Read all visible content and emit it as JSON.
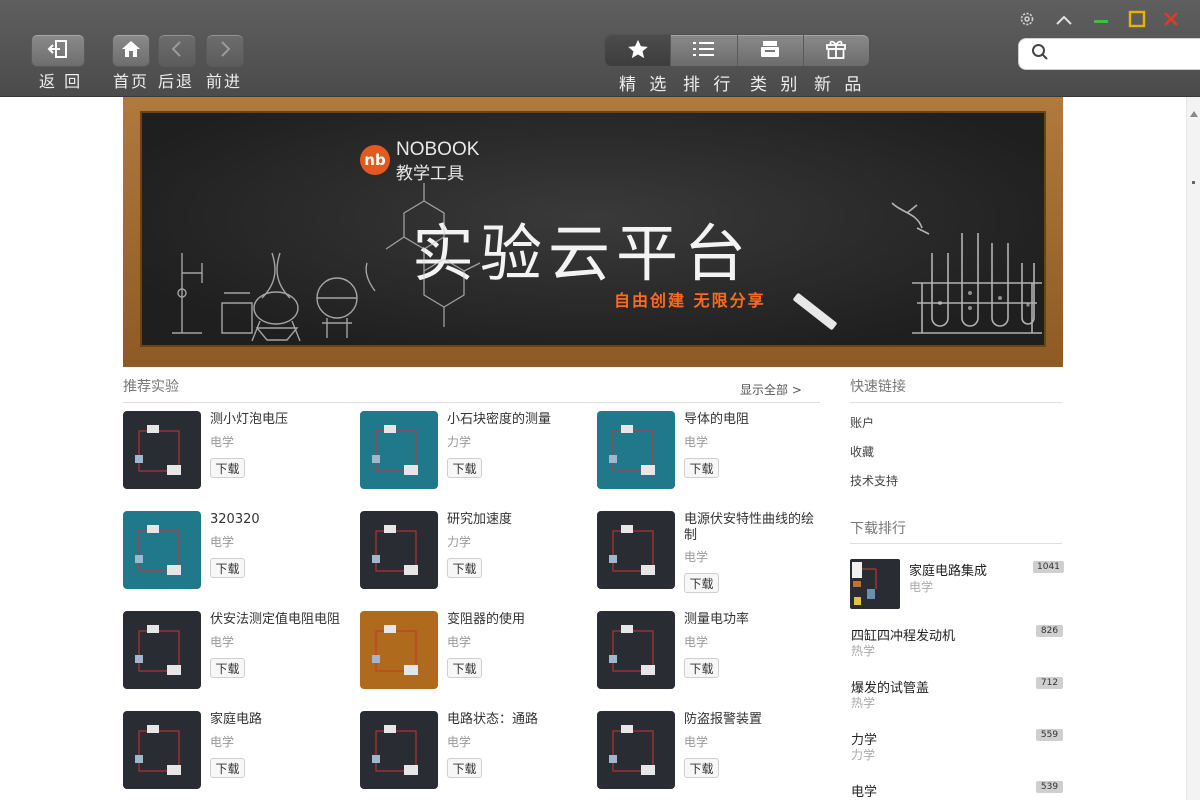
{
  "toolbar": {
    "back_label": "返 回",
    "home_label": "首页",
    "backward_label": "后退",
    "forward_label": "前进",
    "tabs": [
      {
        "label": "精 选",
        "icon": "star-icon"
      },
      {
        "label": "排 行",
        "icon": "list-icon"
      },
      {
        "label": "类 别",
        "icon": "category-icon"
      },
      {
        "label": "新 品",
        "icon": "gift-icon"
      }
    ],
    "active_tab": 0,
    "search": {
      "placeholder": "",
      "value": ""
    }
  },
  "window_controls": [
    "settings-icon",
    "collapse-icon",
    "minimize-icon",
    "maximize-icon",
    "close-icon"
  ],
  "colors": {
    "minimize": "#3fbf3f",
    "maximize": "#e8b400",
    "close": "#e03a2a",
    "accent": "#ff6a1e"
  },
  "banner": {
    "logo_mark": "nb",
    "logo_text": "NOBOOK",
    "logo_subtitle": "教学工具",
    "title": "实验云平台",
    "slogan": "自由创建 无限分享"
  },
  "recommended": {
    "title": "推荐实验",
    "show_all": "显示全部 >",
    "download_label": "下载",
    "items": [
      {
        "name": "测小灯泡电压",
        "category": "电学",
        "thumb": "#2a2c33"
      },
      {
        "name": "小石块密度的测量",
        "category": "力学",
        "thumb": "#20798a"
      },
      {
        "name": "导体的电阻",
        "category": "电学",
        "thumb": "#20798a"
      },
      {
        "name": "320320",
        "category": "电学",
        "thumb": "#20798a"
      },
      {
        "name": "研究加速度",
        "category": "力学",
        "thumb": "#2a2c33"
      },
      {
        "name": "电源伏安特性曲线的绘制",
        "category": "电学",
        "thumb": "#2a2c33"
      },
      {
        "name": "伏安法测定值电阻电阻",
        "category": "电学",
        "thumb": "#2a2c33"
      },
      {
        "name": "变阻器的使用",
        "category": "电学",
        "thumb": "#b06a1e"
      },
      {
        "name": "测量电功率",
        "category": "电学",
        "thumb": "#2a2c33"
      },
      {
        "name": "家庭电路",
        "category": "电学",
        "thumb": "#2a2c33"
      },
      {
        "name": "电路状态：通路",
        "category": "电学",
        "thumb": "#2a2c33"
      },
      {
        "name": "防盗报警装置",
        "category": "电学",
        "thumb": "#2a2c33"
      }
    ]
  },
  "quick_links": {
    "title": "快速链接",
    "items": [
      "账户",
      "收藏",
      "技术支持"
    ]
  },
  "download_rank": {
    "title": "下载排行",
    "items": [
      {
        "name": "家庭电路集成",
        "category": "电学",
        "count": "1041"
      },
      {
        "name": "四缸四冲程发动机",
        "category": "热学",
        "count": "826"
      },
      {
        "name": "爆发的试管盖",
        "category": "热学",
        "count": "712"
      },
      {
        "name": "力学",
        "category": "力学",
        "count": "559"
      },
      {
        "name": "电学",
        "category": "",
        "count": "539"
      }
    ]
  }
}
